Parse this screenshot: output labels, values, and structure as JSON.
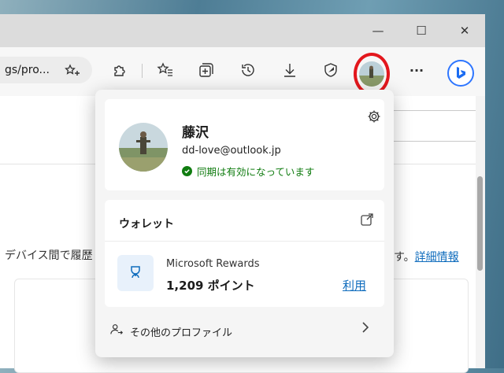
{
  "window": {
    "minimize_glyph": "—",
    "maximize_glyph": "☐",
    "close_glyph": "✕"
  },
  "toolbar": {
    "url_text": "gs/pro...",
    "icons": [
      "favorite-add-icon",
      "extensions-icon",
      "favorites-icon",
      "collections-icon",
      "history-icon",
      "downloads-icon",
      "browser-essentials-icon",
      "profile-avatar",
      "more-icon",
      "bing-icon"
    ],
    "more_label": "···"
  },
  "page": {
    "left_text": "デバイス間で履歴",
    "right_text_prefix": "す。",
    "right_link": "詳細情報"
  },
  "profile_flyout": {
    "name": "藤沢",
    "email": "dd-love@outlook.jp",
    "sync_status": "同期は有効になっています",
    "wallet": {
      "title": "ウォレット",
      "rewards_name": "Microsoft Rewards",
      "points": "1,209 ポイント",
      "use_label": "利用"
    },
    "other_profiles_label": "その他のプロファイル"
  },
  "colors": {
    "accent": "#0f6cbd",
    "sync_green": "#107c10",
    "highlight_ring": "#e3171d"
  }
}
